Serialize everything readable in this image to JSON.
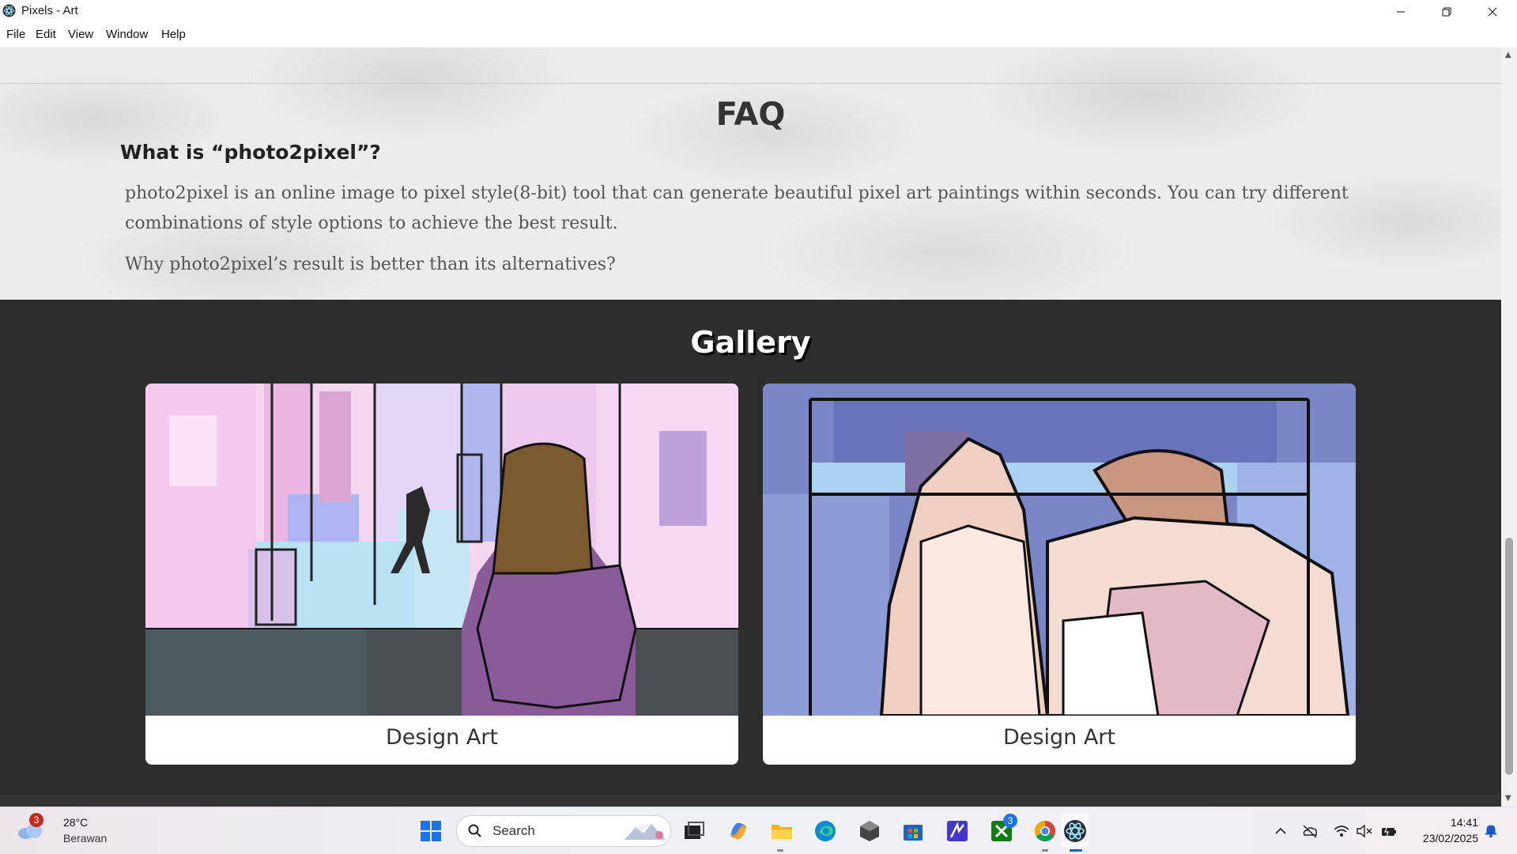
{
  "window": {
    "title": "Pixels - Art",
    "controls": [
      "minimize",
      "restore",
      "close"
    ]
  },
  "menu": [
    "File",
    "Edit",
    "View",
    "Window",
    "Help"
  ],
  "faq": {
    "heading": "FAQ",
    "question1": "What is “photo2pixel”?",
    "answer1": "photo2pixel is an online image to pixel style(8-bit) tool that can generate beautiful pixel art paintings within seconds. You can try different combinations of style options to achieve the best result.",
    "question2": "Why photo2pixel’s result is better than its alternatives?"
  },
  "gallery": {
    "heading": "Gallery",
    "cards": [
      {
        "label": "Design Art",
        "image": "pixel-art-girl-in-pink-city"
      },
      {
        "label": "Design Art",
        "image": "pixel-art-anime-couple"
      }
    ]
  },
  "taskbar": {
    "weather": {
      "temp": "28°C",
      "desc": "Berawan",
      "badge": "3",
      "icon": "cloud-icon"
    },
    "search_placeholder": "Search",
    "apps": [
      "windows-start",
      "task-view",
      "copilot",
      "file-explorer",
      "edge",
      "app-cube",
      "microsoft-store",
      "editor-app",
      "xbox",
      "chrome",
      "electron-app"
    ],
    "xbox_badge": "3",
    "clock": {
      "time": "14:41",
      "date": "23/02/2025"
    }
  },
  "colors": {
    "gallery_bg": "#2d2d2d",
    "faq_bg": "#ececec",
    "accent_taskbar": "#0067c0"
  }
}
